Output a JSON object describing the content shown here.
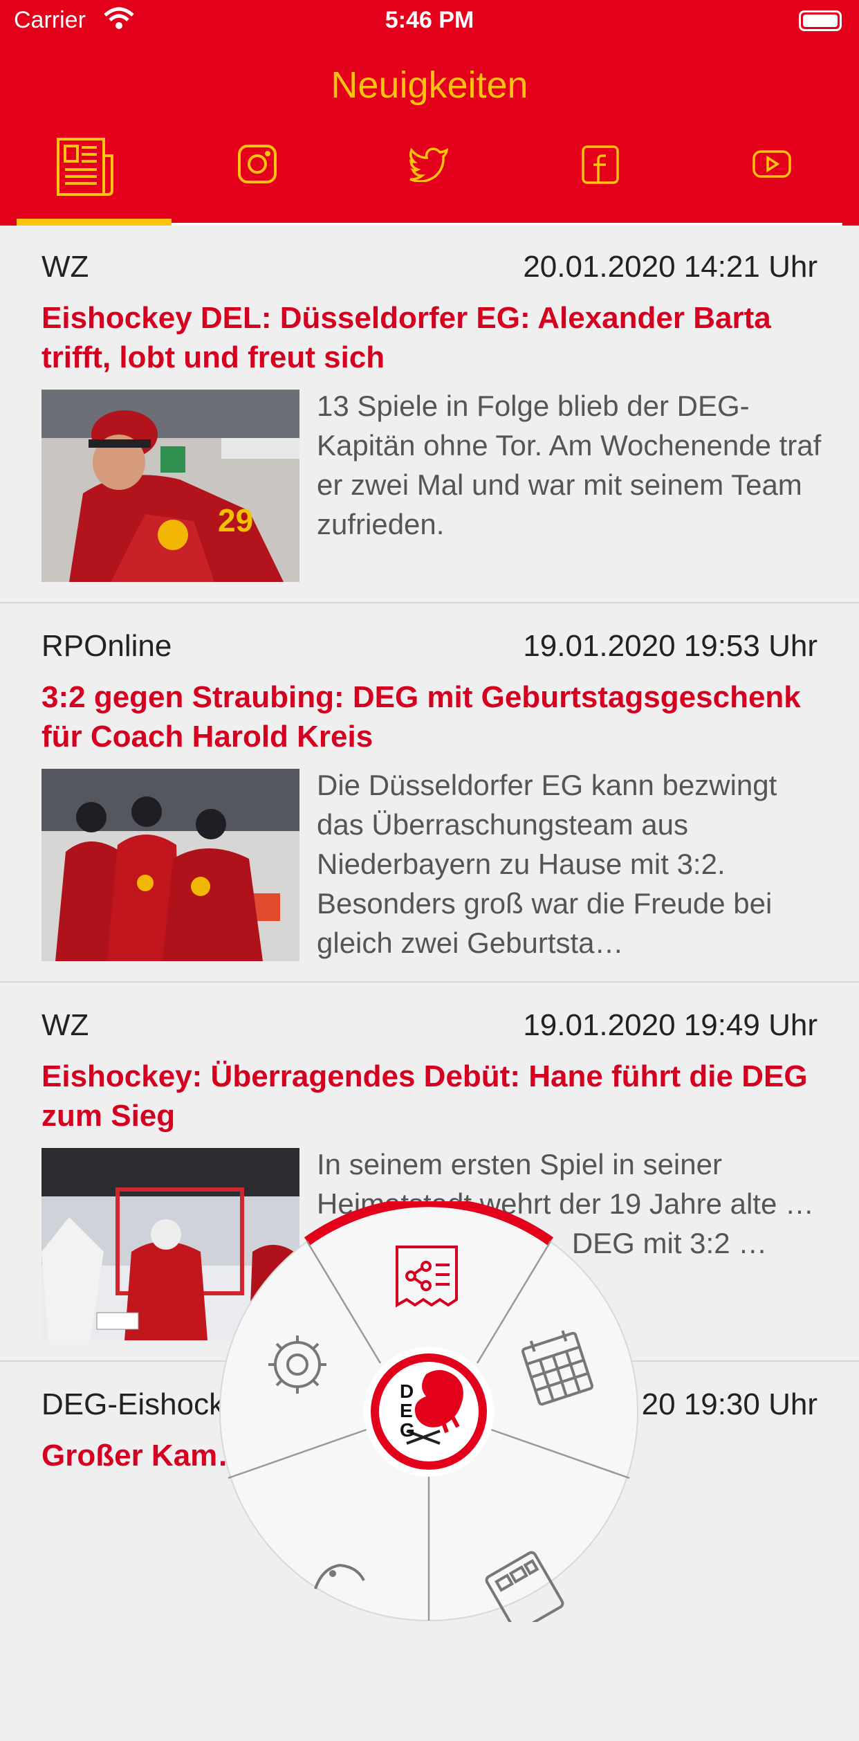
{
  "status_bar": {
    "carrier": "Carrier",
    "time": "5:46 PM"
  },
  "header": {
    "title": "Neuigkeiten",
    "tabs": [
      {
        "icon": "news-icon",
        "active": true
      },
      {
        "icon": "instagram-icon"
      },
      {
        "icon": "twitter-icon"
      },
      {
        "icon": "facebook-icon"
      },
      {
        "icon": "youtube-icon"
      }
    ]
  },
  "colors": {
    "brand_red": "#e2001a",
    "accent_yellow": "#ffc20e",
    "headline_red": "#d5001f"
  },
  "articles": [
    {
      "source": "WZ",
      "date": "20.01.2020 14:21 Uhr",
      "title": "Eishockey DEL: Düsseldorfer EG: Alexander Barta trifft, lobt und freut sich",
      "excerpt": "13 Spiele in Folge blieb der DEG-Kapitän ohne Tor. Am Wochenende traf er zwei Mal und war mit seinem Team zufrieden."
    },
    {
      "source": "RPOnline",
      "date": "19.01.2020 19:53 Uhr",
      "title": "3:2 gegen Straubing: DEG mit Geburtstagsgeschenk für Coach Harold Kreis",
      "excerpt": "Die Düsseldorfer EG kann bezwingt das Überraschungsteam aus Niederbayern zu Hause mit 3:2. Besonders groß war die Freude bei gleich zwei Geburtsta…"
    },
    {
      "source": "WZ",
      "date": "19.01.2020 19:49 Uhr",
      "title": "Eishockey: Überragendes Debüt: Hane führt die DEG zum Sieg",
      "excerpt": "In seinem ersten Spiel in seiner Heimatstadt wehrt der 19 Jahre alte … Schüsse ab. Am … DEG mit 3:2 … rückt wied…"
    },
    {
      "source": "DEG-Eishock…",
      "date": "…20 19:30 Uhr",
      "title": "Großer Kam… t – DEG ringt Straubi…",
      "excerpt": ""
    }
  ],
  "menu_wheel": {
    "center_logo_text": "DEG",
    "segments": [
      "share-news-icon",
      "gear-icon",
      "schedule-icon",
      "ticket-icon",
      "calculator-icon"
    ]
  }
}
